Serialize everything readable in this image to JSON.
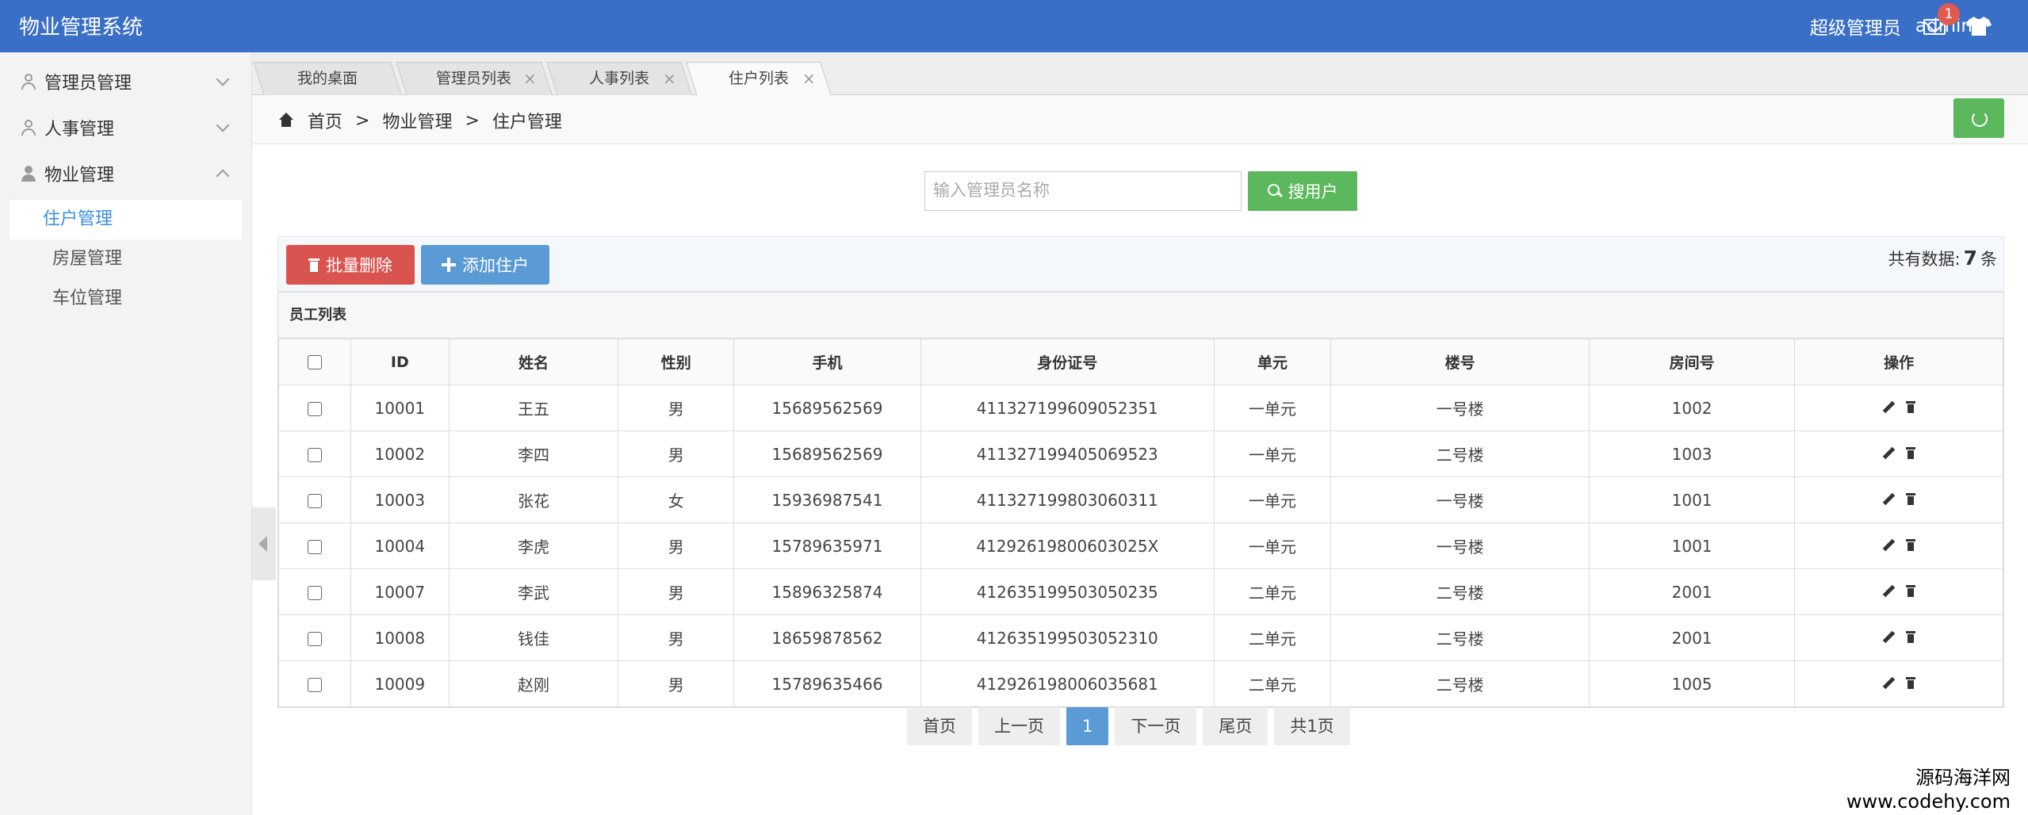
{
  "header": {
    "brand": "物业管理系统",
    "role": "超级管理员",
    "user": "admin",
    "mail_badge": "1"
  },
  "sidebar": {
    "groups": [
      {
        "label": "管理员管理",
        "expanded": false
      },
      {
        "label": "人事管理",
        "expanded": false
      },
      {
        "label": "物业管理",
        "expanded": true,
        "items": [
          {
            "label": "住户管理",
            "active": true
          },
          {
            "label": "房屋管理"
          },
          {
            "label": "车位管理"
          }
        ]
      }
    ]
  },
  "tabs": [
    {
      "label": "我的桌面",
      "close": ""
    },
    {
      "label": "管理员列表",
      "close": "×"
    },
    {
      "label": "人事列表",
      "close": "×"
    },
    {
      "label": "住户列表",
      "close": "×",
      "active": true
    }
  ],
  "breadcrumb": {
    "home": "首页",
    "sep": ">",
    "level1": "物业管理",
    "level2": "住户管理"
  },
  "search": {
    "placeholder": "输入管理员名称",
    "value": "",
    "button": "搜用户"
  },
  "toolbar": {
    "batch_delete": "批量删除",
    "add": "添加住户",
    "total_prefix": "共有数据:",
    "total_count": "7",
    "total_suffix": "条"
  },
  "table": {
    "title": "员工列表",
    "columns": [
      "ID",
      "姓名",
      "性别",
      "手机",
      "身份证号",
      "单元",
      "楼号",
      "房间号",
      "操作"
    ],
    "rows": [
      [
        "10001",
        "王五",
        "男",
        "15689562569",
        "411327199609052351",
        "一单元",
        "一号楼",
        "1002"
      ],
      [
        "10002",
        "李四",
        "男",
        "15689562569",
        "411327199405069523",
        "一单元",
        "二号楼",
        "1003"
      ],
      [
        "10003",
        "张花",
        "女",
        "15936987541",
        "411327199803060311",
        "一单元",
        "一号楼",
        "1001"
      ],
      [
        "10004",
        "李虎",
        "男",
        "15789635971",
        "41292619800603025X",
        "一单元",
        "一号楼",
        "1001"
      ],
      [
        "10007",
        "李武",
        "男",
        "15896325874",
        "412635199503050235",
        "二单元",
        "二号楼",
        "2001"
      ],
      [
        "10008",
        "钱佳",
        "男",
        "18659878562",
        "412635199503052310",
        "二单元",
        "二号楼",
        "2001"
      ],
      [
        "10009",
        "赵刚",
        "男",
        "15789635466",
        "412926198006035681",
        "二单元",
        "二号楼",
        "1005"
      ]
    ]
  },
  "pagination": {
    "first": "首页",
    "prev": "上一页",
    "current": "1",
    "next": "下一页",
    "last": "尾页",
    "total": "共1页"
  },
  "watermark": {
    "line1": "源码海洋网",
    "line2": "www.codehy.com"
  },
  "colors": {
    "header": "#3a6fc8",
    "success": "#5cb85c",
    "danger": "#d9534f",
    "primary": "#5b9bd5",
    "active_link": "#3a8ee6"
  }
}
